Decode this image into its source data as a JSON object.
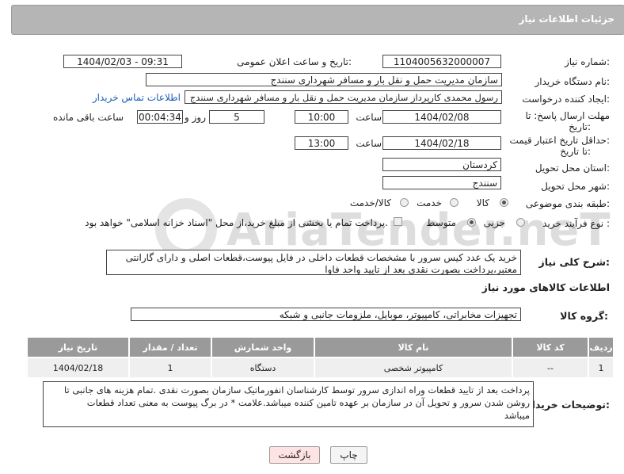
{
  "panel": {
    "title": "جزئیات اطلاعات نیاز"
  },
  "watermark": {
    "text": "AriaTender.neT"
  },
  "fields": {
    "need_number_label": "شماره نیاز:",
    "need_number": "1104005632000007",
    "announce_label": "تاریخ و ساعت اعلان عمومی:",
    "announce_value": "1404/02/03 - 09:31",
    "buyer_org_label": "نام دستگاه خریدار:",
    "buyer_org": "سازمان مدیریت حمل و نقل بار و مسافر شهرداری سنندج",
    "requester_label": "ایجاد کننده درخواست:",
    "requester": "رسول محمدی کارپرداز سازمان مدیریت حمل و نقل بار و مسافر شهرداری سنندج",
    "contact_link": "اطلاعات تماس خریدار",
    "deadline_label_1": "مهلت ارسال پاسخ: تا",
    "deadline_label_2": "تاریخ:",
    "deadline_date": "1404/02/08",
    "time_label": "ساعت",
    "deadline_time": "10:00",
    "days_value": "5",
    "days_label": "روز و",
    "remaining_value": "00:04:34",
    "remaining_label": "ساعت باقی مانده",
    "validity_label_1": "حداقل تاریخ اعتبار قیمت:",
    "validity_label_2": "تا تاریخ:",
    "validity_date": "1404/02/18",
    "validity_time": "13:00",
    "province_label": "استان محل تحویل:",
    "province": "کردستان",
    "city_label": "شهر محل تحویل:",
    "city": "سنندج",
    "category_label": "طبقه بندی موضوعی:",
    "category_options": [
      "کالا",
      "خدمت",
      "کالا/خدمت"
    ],
    "process_label": "نوع فرآیند خرید :",
    "process_options": [
      "جزیی",
      "متوسط"
    ],
    "payment_note": "پرداخت تمام یا بخشی از مبلغ خرید،از محل \"اسناد خزانه اسلامی\" خواهد بود."
  },
  "description": {
    "label": "شرح کلی نیاز:",
    "line1": "خرید یک عدد کیس سرور  با مشخصات قطعات داخلی در فایل پیوست،قطعات اصلی و دارای گارانتی",
    "line2": "معتبر،پرداخت بصورت نقدی بعد از تایید واحد فاوا"
  },
  "goods_section": {
    "title": "اطلاعات کالاهای مورد نیاز",
    "group_label": "گروه کالا:",
    "group_value": "تجهیزات مخابراتی، کامپیوتر، موبایل، ملزومات جانبی و شبکه"
  },
  "table": {
    "headers": [
      "ردیف",
      "کد کالا",
      "نام کالا",
      "واحد شمارش",
      "تعداد / مقدار",
      "تاریخ نیاز"
    ],
    "rows": [
      [
        "1",
        "--",
        "کامپیوتر شخصی",
        "دستگاه",
        "1",
        "1404/02/18"
      ]
    ]
  },
  "buyer_notes": {
    "label": "توضیحات خریدار:",
    "line1": "پرداخت بعد از تایید قطعات وراه اندازی سرور توسط کارشناسان انفورماتیک سازمان بصورت نقدی .تمام هزینه های جانبی تا",
    "line2": "روشن شدن سرور و تحویل آن در سازمان بر عهده تامین کننده میباشد.علامت * در برگ پیوست به معنی تعداد قطعات",
    "line3": "میباشد"
  },
  "buttons": {
    "print": "چاپ",
    "back": "بازگشت"
  }
}
